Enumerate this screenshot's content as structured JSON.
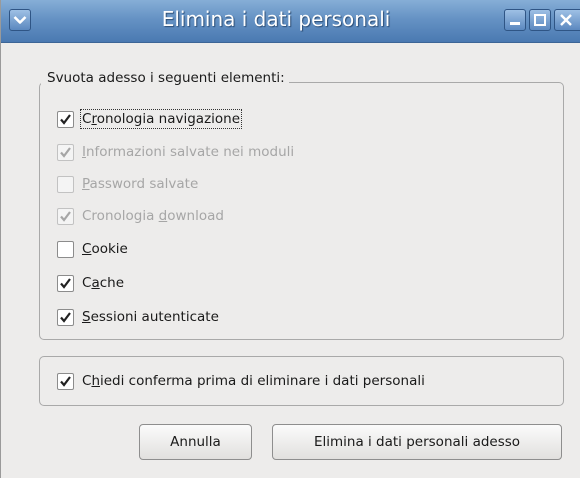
{
  "window": {
    "title": "Elimina i dati personali"
  },
  "items_group": {
    "legend": "Svuota adesso i seguenti elementi:",
    "items": [
      {
        "pre": "C",
        "key": "r",
        "post": "onologia navigazione",
        "checked": true,
        "disabled": false
      },
      {
        "pre": "",
        "key": "I",
        "post": "nformazioni salvate nei moduli",
        "checked": true,
        "disabled": true
      },
      {
        "pre": "",
        "key": "P",
        "post": "assword salvate",
        "checked": false,
        "disabled": true
      },
      {
        "pre": "Cronologia ",
        "key": "d",
        "post": "ownload",
        "checked": true,
        "disabled": true
      },
      {
        "pre": "",
        "key": "C",
        "post": "ookie",
        "checked": false,
        "disabled": false
      },
      {
        "pre": "C",
        "key": "a",
        "post": "che",
        "checked": true,
        "disabled": false
      },
      {
        "pre": "",
        "key": "S",
        "post": "essioni autenticate",
        "checked": true,
        "disabled": false
      }
    ]
  },
  "confirm": {
    "pre": "C",
    "key": "h",
    "post": "iedi conferma prima di eliminare i dati personali",
    "checked": true
  },
  "buttons": {
    "cancel": "Annulla",
    "delete": "Elimina i dati personali adesso"
  },
  "icons": {
    "menu": "chevron-down-icon",
    "minimize": "minimize-icon",
    "maximize": "maximize-icon",
    "close": "close-icon",
    "check": "checkmark-icon"
  },
  "colors": {
    "titlebar": "#5b88bf",
    "window_bg": "#edeceb",
    "disabled_text": "#a6a6a6"
  }
}
